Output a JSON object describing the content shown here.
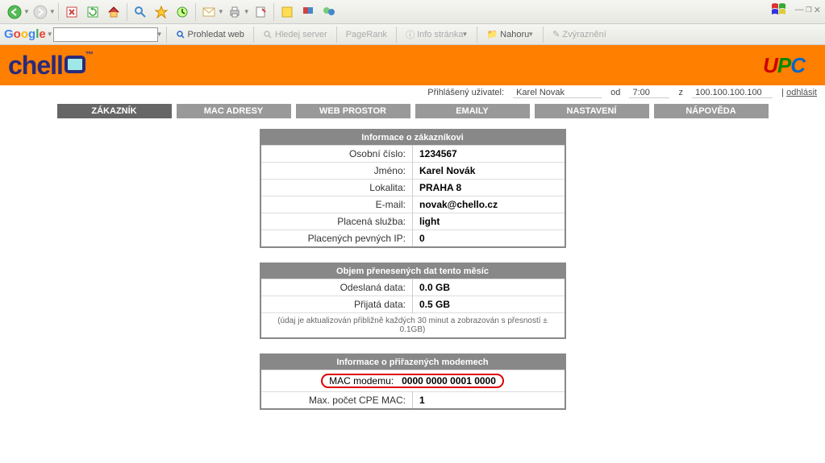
{
  "google_toolbar": {
    "search_btn": "Prohledat web",
    "server_btn": "Hledej server",
    "pagerank": "PageRank",
    "info": "Info stránka",
    "up": "Nahoru",
    "highlight": "Zvýraznění"
  },
  "brand": {
    "chello": "chell",
    "upc": "UPC"
  },
  "status": {
    "logged_label": "Přihlášený uživatel:",
    "user": "Karel Novak",
    "od_label": "od",
    "od_val": "7:00",
    "z_label": "z",
    "ip": "100.100.100.100",
    "logout": "odhlásit"
  },
  "tabs": {
    "zakaznik": "ZÁKAZNÍK",
    "mac": "MAC ADRESY",
    "web": "WEB PROSTOR",
    "email": "EMAILY",
    "nastaveni": "NASTAVENÍ",
    "napoveda": "NÁPOVĚDA"
  },
  "panel1": {
    "title": "Informace o zákazníkovi",
    "r1l": "Osobní číslo:",
    "r1v": "1234567",
    "r2l": "Jméno:",
    "r2v": "Karel Novák",
    "r3l": "Lokalita:",
    "r3v": "PRAHA 8",
    "r4l": "E-mail:",
    "r4v": "novak@chello.cz",
    "r5l": "Placená služba:",
    "r5v": "light",
    "r6l": "Placených pevných IP:",
    "r6v": "0"
  },
  "panel2": {
    "title": "Objem přenesených dat tento měsíc",
    "r1l": "Odeslaná data:",
    "r1v": "0.0 GB",
    "r2l": "Přijatá data:",
    "r2v": "0.5 GB",
    "note": "(údaj je aktualizován přibližně každých 30 minut a zobrazován s přesností ± 0.1GB)"
  },
  "panel3": {
    "title": "Informace o přiřazených modemech",
    "r1l": "MAC modemu:",
    "r1v": "0000 0000 0001 0000",
    "r2l": "Max. počet CPE MAC:",
    "r2v": "1"
  }
}
